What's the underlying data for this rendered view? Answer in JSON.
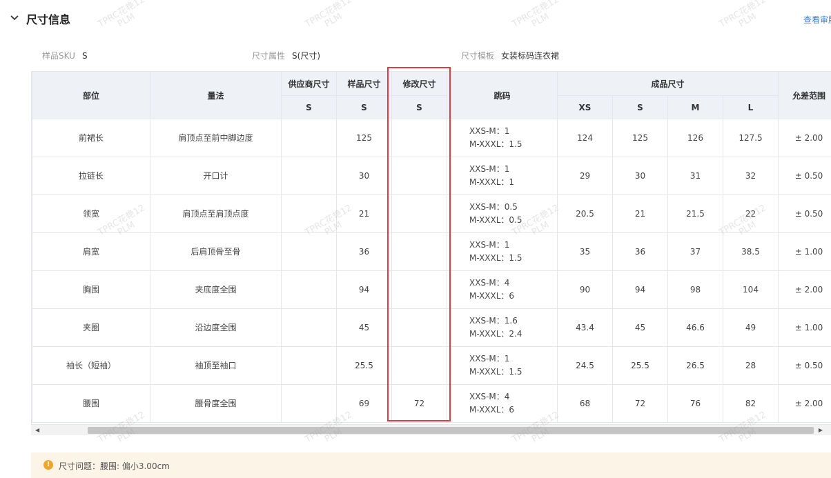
{
  "section": {
    "title": "尺寸信息",
    "audit_link": "查看审版"
  },
  "meta": {
    "sku_label": "样品SKU",
    "sku_value": "S",
    "attr_label": "尺寸属性",
    "attr_value": "S(尺寸)",
    "template_label": "尺寸模板",
    "template_value": "女装标码连衣裙"
  },
  "table": {
    "headers": {
      "part": "部位",
      "method": "量法",
      "supplier_size": "供应商尺寸",
      "sample_size": "样品尺寸",
      "modify_size": "修改尺寸",
      "jump": "跳码",
      "finished_size": "成品尺寸",
      "tolerance": "允差范围",
      "supplier_sub": "S",
      "sample_sub": "S",
      "modify_sub": "S",
      "finished_sizes": [
        "XS",
        "S",
        "M",
        "L"
      ]
    },
    "rows": [
      {
        "part": "前裙长",
        "method": "肩顶点至前中脚边度",
        "supplier": "",
        "sample": "125",
        "modify": "",
        "jump1": "XXS-M：1",
        "jump2": "M-XXXL：1.5",
        "xs": "124",
        "s": "125",
        "m": "126",
        "l": "127.5",
        "tol": "± 2.00"
      },
      {
        "part": "拉链长",
        "method": "开口计",
        "supplier": "",
        "sample": "30",
        "modify": "",
        "jump1": "XXS-M：1",
        "jump2": "M-XXXL：1",
        "xs": "29",
        "s": "30",
        "m": "31",
        "l": "32",
        "tol": "± 0.50"
      },
      {
        "part": "领宽",
        "method": "肩顶点至肩顶点度",
        "supplier": "",
        "sample": "21",
        "modify": "",
        "jump1": "XXS-M：0.5",
        "jump2": "M-XXXL：0.5",
        "xs": "20.5",
        "s": "21",
        "m": "21.5",
        "l": "22",
        "tol": "± 0.50"
      },
      {
        "part": "肩宽",
        "method": "后肩顶骨至骨",
        "supplier": "",
        "sample": "36",
        "modify": "",
        "jump1": "XXS-M：1",
        "jump2": "M-XXXL：1.5",
        "xs": "35",
        "s": "36",
        "m": "37",
        "l": "38.5",
        "tol": "± 1.00"
      },
      {
        "part": "胸围",
        "method": "夹底度全围",
        "supplier": "",
        "sample": "94",
        "modify": "",
        "jump1": "XXS-M：4",
        "jump2": "M-XXXL：6",
        "xs": "90",
        "s": "94",
        "m": "98",
        "l": "104",
        "tol": "± 2.00"
      },
      {
        "part": "夹圈",
        "method": "沿边度全围",
        "supplier": "",
        "sample": "45",
        "modify": "",
        "jump1": "XXS-M：1.6",
        "jump2": "M-XXXL：2.4",
        "xs": "43.4",
        "s": "45",
        "m": "46.6",
        "l": "49",
        "tol": "± 1.00"
      },
      {
        "part": "袖长（短袖）",
        "method": "袖顶至袖口",
        "supplier": "",
        "sample": "25.5",
        "modify": "",
        "jump1": "XXS-M：1",
        "jump2": "M-XXXL：1.5",
        "xs": "24.5",
        "s": "25.5",
        "m": "26.5",
        "l": "28",
        "tol": "± 0.50"
      },
      {
        "part": "腰围",
        "method": "腰骨度全围",
        "supplier": "",
        "sample": "69",
        "modify": "72",
        "jump1": "XXS-M：4",
        "jump2": "M-XXXL：6",
        "xs": "68",
        "s": "72",
        "m": "76",
        "l": "82",
        "tol": "± 2.00"
      }
    ]
  },
  "warning": {
    "icon": "exclamation-icon",
    "text": "尺寸问题：腰围: 偏小3.00cm"
  },
  "watermark": {
    "line1": "TPRC花艳12",
    "line2": "PLM"
  },
  "colors": {
    "highlight": "#e13b3b",
    "link": "#3a7fd5",
    "header_bg": "#eef1f6",
    "warning_bg": "#fdf4e8",
    "warning_icon": "#f3a52a"
  }
}
